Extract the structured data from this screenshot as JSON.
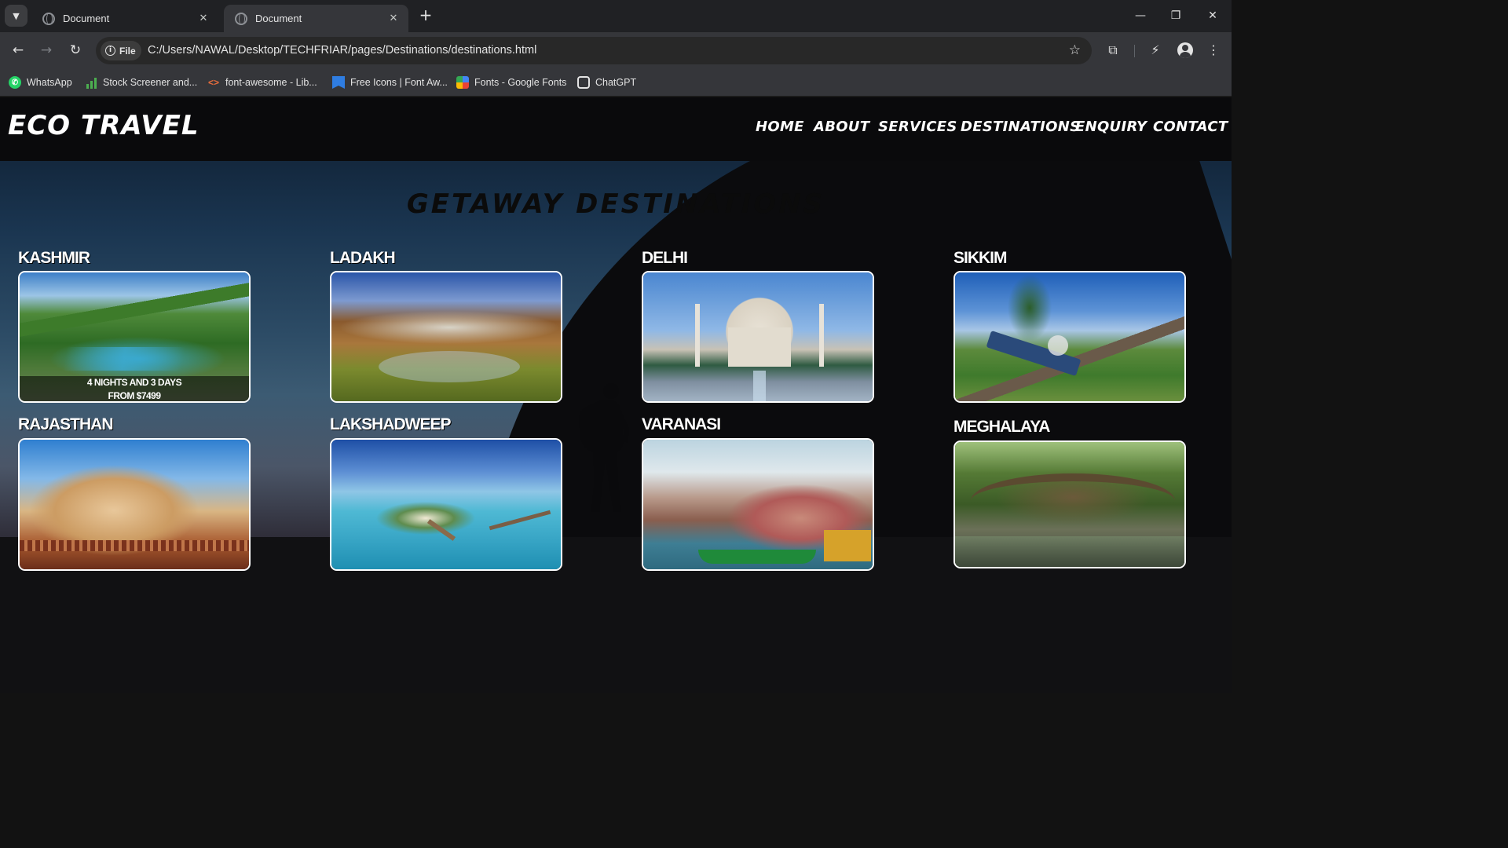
{
  "browser": {
    "tabs": [
      {
        "title": "Document"
      },
      {
        "title": "Document"
      }
    ],
    "site_chip": "File",
    "url": "C:/Users/NAWAL/Desktop/TECHFRIAR/pages/Destinations/destinations.html",
    "bookmarks": [
      {
        "label": "WhatsApp",
        "icon": "whatsapp-icon"
      },
      {
        "label": "Stock Screener and...",
        "icon": "chart-bars-icon"
      },
      {
        "label": "font-awesome - Lib...",
        "icon": "code-icon"
      },
      {
        "label": "Free Icons | Font Aw...",
        "icon": "flag-icon"
      },
      {
        "label": "Fonts - Google Fonts",
        "icon": "google-fonts-icon"
      },
      {
        "label": "ChatGPT",
        "icon": "chatgpt-icon"
      }
    ]
  },
  "site": {
    "logo": "ECO TRAVEL",
    "nav": [
      "HOME",
      "ABOUT",
      "SERVICES",
      "DESTINATIONS",
      "ENQUIRY",
      "CONTACT"
    ],
    "section_title": "GETAWAY DESTINATIONS",
    "destinations": [
      {
        "name": "KASHMIR",
        "overlay_line1": "4 NIGHTS AND 3 DAYS",
        "overlay_line2": "FROM  $7499"
      },
      {
        "name": "LADAKH"
      },
      {
        "name": "DELHI"
      },
      {
        "name": "SIKKIM"
      },
      {
        "name": "RAJASTHAN"
      },
      {
        "name": "LAKSHADWEEP"
      },
      {
        "name": "VARANASI"
      },
      {
        "name": "MEGHALAYA"
      }
    ]
  },
  "colors": {
    "tabstrip": "#202124",
    "toolbar": "#35363a",
    "header": "#0a0a0c",
    "title_text": "#0b0b0b",
    "sunset": "#e96c46"
  }
}
